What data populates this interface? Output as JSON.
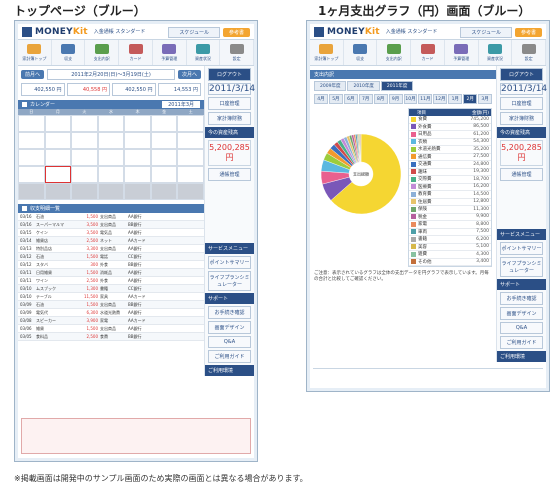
{
  "captions": {
    "left": "トップページ（ブルー）",
    "right": "1ヶ月支出グラフ（円）画面（ブルー）"
  },
  "footnote": "※掲載画面は開発中のサンプル画面のため実際の画面とは異なる場合があります。",
  "app": {
    "logo": "MONEY",
    "logo_accent": "Kit",
    "plan_label": "入金通帳 スタンダード",
    "schedule_label": "スケジュール",
    "help_label": "参考書",
    "logout_label": "ログアウト"
  },
  "left": {
    "nav": [
      "家計簿トップ",
      "収支",
      "支出内訳",
      "カード",
      "予算管理",
      "資産状況",
      "設定"
    ],
    "range_text": "2011年2月20日(日)〜3月19日(土)",
    "prev_label": "前月へ",
    "next_label": "次月へ",
    "date": "2011/3/14",
    "balance_amounts": [
      "402,550 円",
      "40,558 円",
      "402,550 円",
      "14,553 円"
    ],
    "calendar_title": "カレンダー",
    "calendar_month": "2011年3月",
    "weekdays": [
      "日",
      "月",
      "火",
      "水",
      "木",
      "金",
      "土"
    ],
    "list_title": "収支明細一覧",
    "list_rows": [
      [
        "03/16",
        "石油",
        "1,500",
        "支出商品",
        "AA銀行"
      ],
      [
        "03/16",
        "スーパーマルマ",
        "3,500",
        "支出商品",
        "BB銀行"
      ],
      [
        "03/15",
        "ケイン",
        "3,500",
        "電気品",
        "AA銀行"
      ],
      [
        "03/14",
        "雑貨店",
        "2,500",
        "ネット",
        "AAカード"
      ],
      [
        "03/13",
        "特別品店",
        "3,300",
        "支出商品",
        "AA銀行"
      ],
      [
        "03/12",
        "石油",
        "1,500",
        "電話",
        "CC銀行"
      ],
      [
        "03/12",
        "スタバ",
        "300",
        "外食",
        "BB銀行"
      ],
      [
        "03/11",
        "日用雑貨",
        "1,500",
        "消耗品",
        "AA銀行"
      ],
      [
        "03/11",
        "ワイン",
        "2,500",
        "外食",
        "AA銀行"
      ],
      [
        "03/10",
        "ムスブック",
        "1,300",
        "書籍",
        "CC銀行"
      ],
      [
        "03/10",
        "テーブル",
        "11,500",
        "家具",
        "AAカード"
      ],
      [
        "03/09",
        "石油",
        "1,500",
        "支出商品",
        "BB銀行"
      ],
      [
        "03/09",
        "電気代",
        "6,300",
        "水道光熱費",
        "AA銀行"
      ],
      [
        "03/08",
        "スピーカー",
        "3,900",
        "家電",
        "AAカード"
      ],
      [
        "03/06",
        "雑貨",
        "1,500",
        "支出商品",
        "AA銀行"
      ],
      [
        "03/05",
        "食料品",
        "2,500",
        "食費",
        "BB銀行"
      ]
    ],
    "side": {
      "badge": "口座管理",
      "card_badge": "家計簿財務",
      "asset_head": "今の資産残高",
      "asset_value": "5,200,285 円",
      "bank_badge": "通帳管理",
      "service_head": "サービスメニュー",
      "service_btn1": "ポイントサマリー",
      "service_btn2": "ライフプランシミュレーター",
      "support_head": "サポート",
      "support_btn1": "お手続き確認",
      "support_btn2": "画面デザイン",
      "support_btn3": "Q&A",
      "support_btn4": "ご利用ガイド",
      "env_head": "ご利用環境"
    }
  },
  "right": {
    "nav": [
      "家計簿トップ",
      "収支",
      "支出内訳",
      "カード",
      "予算管理",
      "資産状況",
      "設定"
    ],
    "date": "2011/3/14",
    "section_title": "支出内訳",
    "year_tabs": [
      "2009年度",
      "2010年度",
      "2011年度"
    ],
    "active_year": 2,
    "months": [
      "4月",
      "5月",
      "6月",
      "7月",
      "8月",
      "9月",
      "10月",
      "11月",
      "12月",
      "1月",
      "2月",
      "3月"
    ],
    "active_month": 10,
    "pie_center": "支出総額",
    "table_headers": [
      "項目",
      "金額(円)"
    ],
    "note_text": "ご注意：表示されているグラフは全体の支出データを円グラフで表示しています。月毎の合計と比較してご確認ください。",
    "side": {
      "badge": "口座管理",
      "card_badge": "家計簿財務",
      "asset_head": "今の資産残高",
      "asset_value": "5,200,285 円",
      "bank_badge": "通帳管理",
      "service_head": "サービスメニュー",
      "service_btn1": "ポイントサマリー",
      "service_btn2": "ライフプランシミュレーター",
      "support_head": "サポート",
      "support_btn1": "お手続き確認",
      "support_btn2": "画面デザイン",
      "support_btn3": "Q&A",
      "support_btn4": "ご利用ガイド",
      "env_head": "ご利用環境"
    }
  },
  "chart_data": {
    "type": "pie",
    "title": "",
    "categories": [
      "食費",
      "外食費",
      "日用品",
      "衣類",
      "水道光熱費",
      "通信費",
      "交通費",
      "趣味",
      "交際費",
      "医療費",
      "教育費",
      "住居費",
      "保険",
      "税金",
      "家電",
      "車両",
      "書籍",
      "美容",
      "雑費",
      "その他"
    ],
    "values": [
      745200,
      86500,
      61200,
      54300,
      35200,
      27500,
      24800,
      19300,
      18700,
      16200,
      14500,
      12800,
      11300,
      9900,
      8800,
      7500,
      6200,
      5100,
      4300,
      3400
    ],
    "colors": [
      "#f5d632",
      "#7a57b8",
      "#e9608f",
      "#5bb8e0",
      "#9ccc3c",
      "#f29a2e",
      "#3a6fbf",
      "#d04a4a",
      "#48b08a",
      "#c28ad8",
      "#8db0d8",
      "#e7c36a",
      "#6fa66c",
      "#b65f9e",
      "#e98b5e",
      "#4d9fa8",
      "#a9a9a9",
      "#d6b84a",
      "#88c2a1",
      "#c36f3a"
    ],
    "legend": "right"
  }
}
